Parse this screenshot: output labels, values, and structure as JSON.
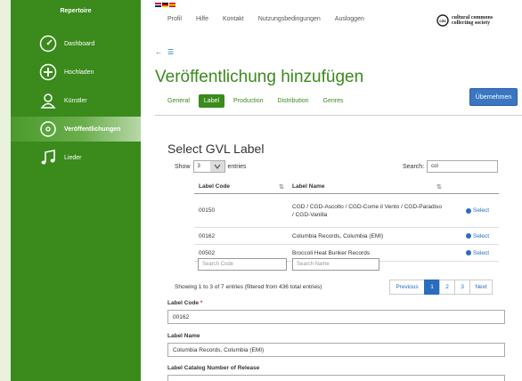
{
  "sidebar": {
    "title": "Repertoire",
    "items": [
      {
        "label": "Dashboard",
        "icon": "dashboard-icon"
      },
      {
        "label": "Hochladen",
        "icon": "plus-circle-icon"
      },
      {
        "label": "Künstler",
        "icon": "user-icon"
      },
      {
        "label": "Veröffentlichungen",
        "icon": "disc-icon",
        "active": true
      },
      {
        "label": "Lieder",
        "icon": "music-note-icon"
      }
    ]
  },
  "header": {
    "languages": [
      "en",
      "de",
      "es"
    ],
    "nav": [
      "Profil",
      "Hilfe",
      "Kontakt",
      "Nutzungsbedingungen",
      "Ausloggen"
    ],
    "logo_line1": "cultural commons",
    "logo_line2": "collecting society",
    "logo_mark": "c3s"
  },
  "page": {
    "title": "Veröffentlichung hinzufügen",
    "tabs": [
      "General",
      "Label",
      "Production",
      "Distribution",
      "Genres"
    ],
    "active_tab": "Label",
    "save_label": "Übernehmen"
  },
  "table": {
    "section_title": "Select GVL Label",
    "show_label": "Show",
    "show_value": "3",
    "entries_label": "entries",
    "search_label": "Search:",
    "search_value": "col",
    "columns": [
      "Label Code",
      "Label Name"
    ],
    "rows": [
      {
        "code": "00150",
        "name": "CGD / CGD-Ascolto / CGD-Come il Vento / CGD-Paradiso / CGD-Vanilla",
        "action": "Select"
      },
      {
        "code": "00162",
        "name": "Columbia Records, Columbia (EMI)",
        "action": "Select"
      },
      {
        "code": "00502",
        "name": "Broccoli Heat Bunker Records",
        "action": "Select"
      }
    ],
    "filter_code_placeholder": "Search Code",
    "filter_name_placeholder": "Search Name",
    "info": "Showing 1 to 3 of 7 entries (filtered from 436 total entries)",
    "pager": {
      "prev": "Previous",
      "pages": [
        "1",
        "2",
        "3"
      ],
      "active": "1",
      "next": "Next"
    }
  },
  "form": {
    "label_code_label": "Label Code",
    "required_mark": "*",
    "label_code_value": "00162",
    "label_name_label": "Label Name",
    "label_name_value": "Columbia Records, Columbia (EMI)",
    "catalog_label": "Label Catalog Number of Release"
  },
  "colors": {
    "brand_green": "#3a8a1c",
    "accent_blue": "#2a6cc0"
  }
}
